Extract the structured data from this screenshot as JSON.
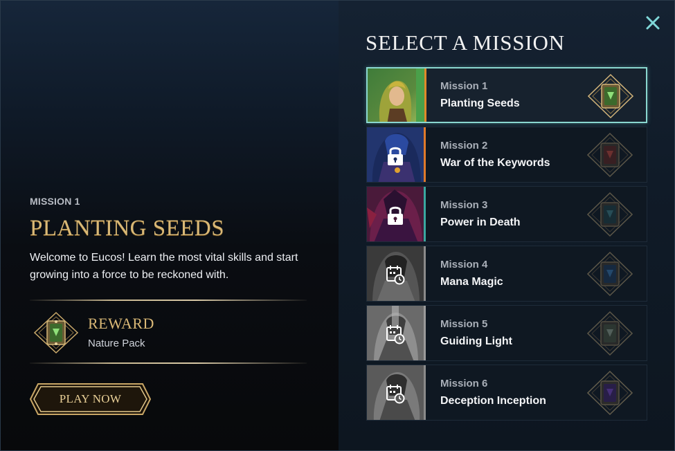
{
  "detail": {
    "kicker": "MISSION 1",
    "title": "PLANTING SEEDS",
    "description": "Welcome to Eucos! Learn the most vital skills and start growing into a force to be reckoned with.",
    "reward_label": "REWARD",
    "reward_value": "Nature Pack",
    "play_label": "PLAY NOW"
  },
  "list": {
    "title": "SELECT A MISSION",
    "missions": [
      {
        "number": "Mission 1",
        "name": "Planting Seeds",
        "state": "active",
        "pack_color": "#7fbf4a"
      },
      {
        "number": "Mission 2",
        "name": "War of the Keywords",
        "state": "locked",
        "pack_color": "#b8443b"
      },
      {
        "number": "Mission 3",
        "name": "Power in Death",
        "state": "locked",
        "pack_color": "#3c7a84"
      },
      {
        "number": "Mission 4",
        "name": "Mana Magic",
        "state": "scheduled",
        "pack_color": "#3570a8"
      },
      {
        "number": "Mission 5",
        "name": "Guiding Light",
        "state": "scheduled",
        "pack_color": "#8a9a88"
      },
      {
        "number": "Mission 6",
        "name": "Deception Inception",
        "state": "scheduled",
        "pack_color": "#6a3fb0"
      }
    ]
  },
  "colors": {
    "gold": "#d9b876",
    "active_border": "#8ad7d0",
    "close": "#7fd7d8"
  },
  "icons": [
    "close-icon",
    "lock-icon",
    "calendar-clock-icon",
    "card-pack-icon"
  ]
}
